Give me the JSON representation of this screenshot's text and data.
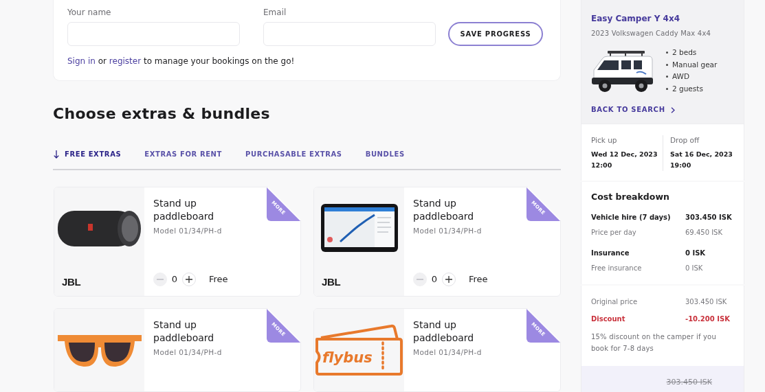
{
  "contact_form": {
    "fields": [
      {
        "label": "Your name"
      },
      {
        "label": "Email"
      }
    ],
    "save_button": "SAVE PROGRESS",
    "account_prompt": {
      "sign_in_link": "Sign in",
      "joiner": "or",
      "register_link": "register",
      "rest": "to manage your bookings on the go!"
    }
  },
  "extras_section": {
    "title": "Choose extras & bundles",
    "tabs": [
      {
        "label": "FREE EXTRAS",
        "selected": true
      },
      {
        "label": "EXTRAS FOR RENT",
        "selected": false
      },
      {
        "label": "PURCHASABLE EXTRAS",
        "selected": false
      },
      {
        "label": "BUNDLES",
        "selected": false
      }
    ],
    "items": [
      {
        "title": "Stand up paddleboard",
        "model": "Model 01/34/PH-d",
        "ribbon": "MORE",
        "brand": "JBL",
        "stepper": {
          "quantity": "0",
          "decrease_disabled": true
        },
        "price": "Free"
      },
      {
        "title": "Stand up paddleboard",
        "model": "Model 01/34/PH-d",
        "ribbon": "MORE",
        "brand": "JBL",
        "stepper": {
          "quantity": "0",
          "decrease_disabled": true
        },
        "price": "Free"
      },
      {
        "title": "Stand up paddleboard",
        "model": "Model 01/34/PH-d",
        "ribbon": "MORE"
      },
      {
        "title": "Stand up paddleboard",
        "model": "Model 01/34/PH-d",
        "ribbon": "MORE",
        "image_text": "flybus"
      }
    ]
  },
  "vehicle": {
    "name": "Easy Camper Y 4x4",
    "model": "2023 Volkswagen Caddy Max 4x4",
    "features": [
      "2 beds",
      "Manual gear",
      "AWD",
      "2 guests"
    ],
    "back_link": "BACK TO SEARCH"
  },
  "trip": [
    {
      "label": "Pick up",
      "date": "Wed 12 Dec, 2023",
      "time": "12:00"
    },
    {
      "label": "Drop off",
      "date": "Sat 16 Dec, 2023",
      "time": "19:00"
    }
  ],
  "cost_breakdown": {
    "title": "Cost breakdown",
    "lines": [
      {
        "kind": "main",
        "label": "Vehicle hire (7 days)",
        "value": "303.450 ISK"
      },
      {
        "kind": "detail",
        "label": "Price per day",
        "value": "69.450 ISK"
      },
      {
        "kind": "main",
        "label": "Insurance",
        "value": "0 ISK"
      },
      {
        "kind": "detail",
        "label": "Free insurance",
        "value": "0 ISK"
      }
    ]
  },
  "discount": {
    "lines": [
      {
        "kind": "detail",
        "label": "Original price",
        "value": "303.450 ISK"
      },
      {
        "kind": "discount",
        "label": "Discount",
        "value": "-10.200 ISK"
      }
    ],
    "note": "15% discount on the camper if you book for 7-8 days"
  },
  "total": {
    "price": "303.450 ISK",
    "struck_through": true
  }
}
